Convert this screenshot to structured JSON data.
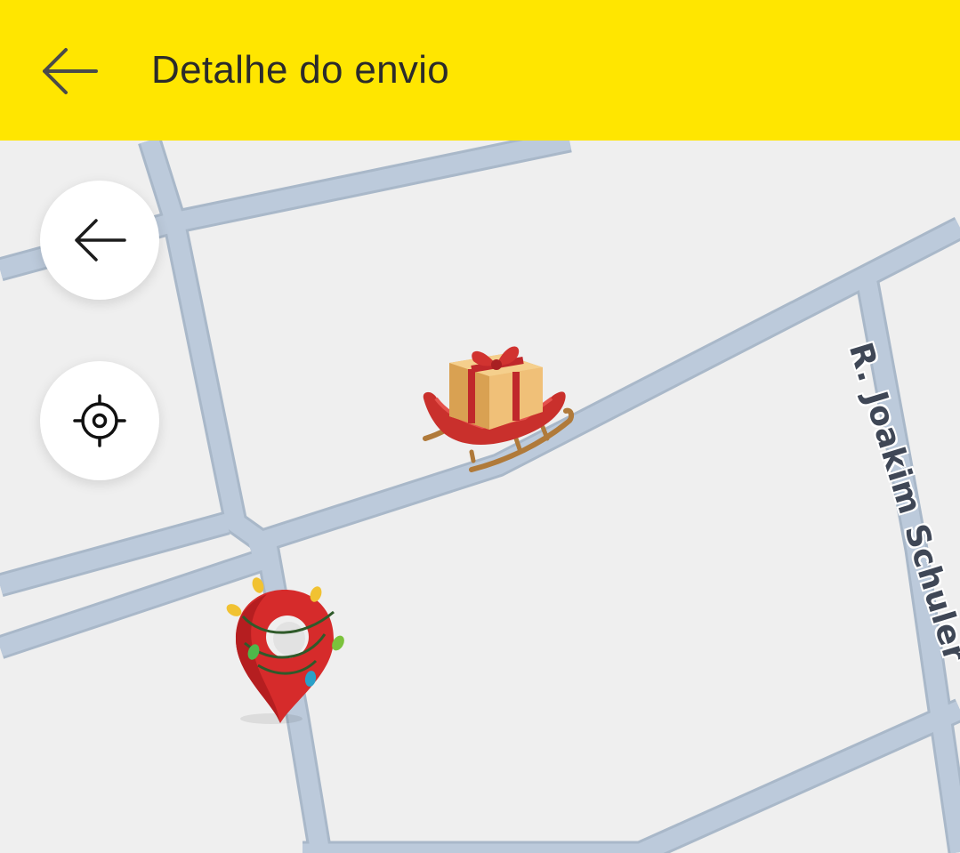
{
  "header": {
    "title": "Detalhe do envio",
    "back_icon": "arrow-left-icon",
    "background_color": "#ffe600"
  },
  "map": {
    "background_color": "#efefef",
    "road_color": "#b8c6d6",
    "street_label": "R. Joakim Schuler",
    "controls": {
      "back_icon": "arrow-left-icon",
      "locate_icon": "crosshair-icon"
    },
    "markers": {
      "courier_icon": "sleigh-with-gift-icon",
      "destination_icon": "location-pin-with-lights-icon"
    }
  }
}
